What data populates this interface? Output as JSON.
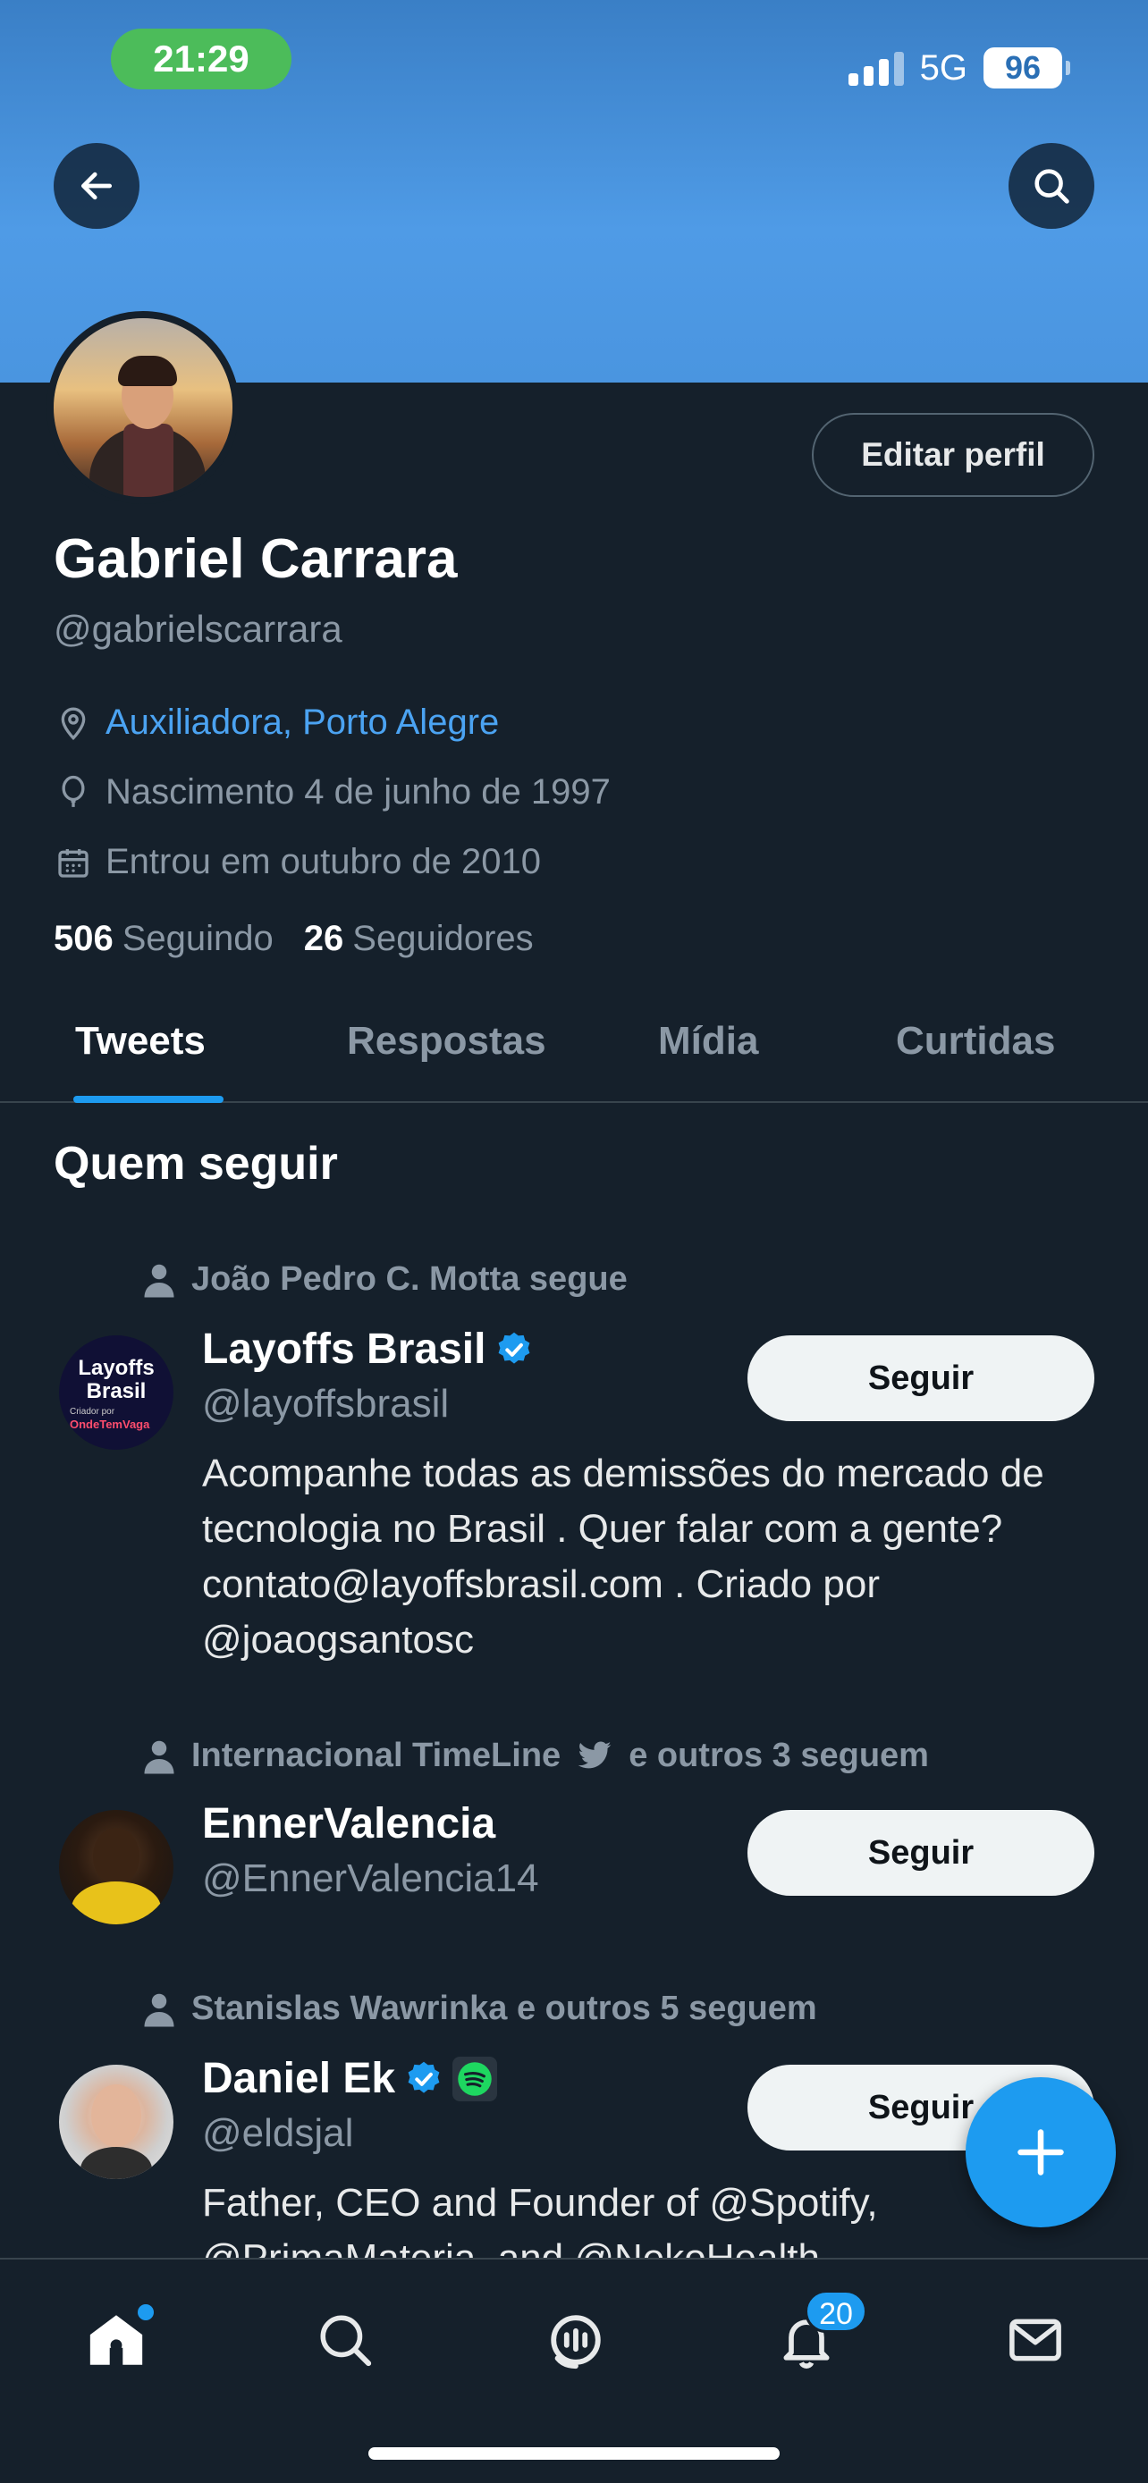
{
  "status_bar": {
    "time": "21:29",
    "network": "5G",
    "battery": "96"
  },
  "colors": {
    "accent": "#1d9bf0",
    "banner": "#4a95e0",
    "background": "#15202b",
    "link": "#4ba3f2"
  },
  "header": {
    "back_icon": "arrow-left-icon",
    "search_icon": "search-icon"
  },
  "profile": {
    "edit_label": "Editar perfil",
    "name": "Gabriel Carrara",
    "handle": "@gabrielscarrara",
    "location": "Auxiliadora, Porto Alegre",
    "birth": "Nascimento 4 de junho de 1997",
    "joined": "Entrou em outubro de 2010",
    "following_count": "506",
    "following_label": "Seguindo",
    "followers_count": "26",
    "followers_label": "Seguidores"
  },
  "tabs": [
    {
      "label": "Tweets"
    },
    {
      "label": "Respostas"
    },
    {
      "label": "Mídia"
    },
    {
      "label": "Curtidas"
    }
  ],
  "who_to_follow": {
    "title": "Quem seguir",
    "items": [
      {
        "social": "João Pedro C. Motta segue",
        "name": "Layoffs Brasil",
        "handle": "@layoffsbrasil",
        "bio": "Acompanhe todas as demissões do mercado de tecnologia no Brasil . Quer falar com a gente? contato@layoffsbrasil.com . Criado por @joaogsantosc",
        "follow_label": "Seguir",
        "avatar_text": "Layoffs Brasil",
        "avatar_subtext": "Criador por",
        "avatar_brand": "OndeTemVaga"
      },
      {
        "social_prefix": "Internacional TimeLine",
        "social_suffix": "e outros 3 seguem",
        "name": "EnnerValencia",
        "handle": "@EnnerValencia14",
        "follow_label": "Seguir"
      },
      {
        "social": "Stanislas Wawrinka e outros 5 seguem",
        "name": "Daniel Ek",
        "handle": "@eldsjal",
        "bio": "Father, CEO and Founder of @Spotify, @PrimaMateria, and @NekoHealth",
        "follow_label": "Seguir"
      }
    ]
  },
  "bottom_nav": {
    "items": [
      "home-icon",
      "search-icon",
      "spaces-icon",
      "notifications-icon",
      "messages-icon"
    ],
    "notifications_count": "20"
  }
}
